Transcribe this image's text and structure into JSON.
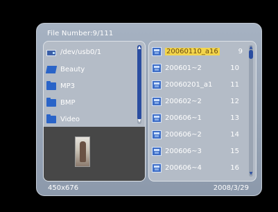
{
  "header": {
    "file_number": "File Number:9/111"
  },
  "footer": {
    "resolution": "450x676",
    "date": "2008/3/29"
  },
  "directory_list": {
    "items": [
      {
        "label": "/dev/usb0/1",
        "icon": "drive-icon"
      },
      {
        "label": "Beauty",
        "icon": "folder-open-icon"
      },
      {
        "label": "MP3",
        "icon": "folder-icon"
      },
      {
        "label": "BMP",
        "icon": "folder-icon"
      },
      {
        "label": "Video",
        "icon": "folder-icon"
      }
    ]
  },
  "preview": {
    "icon": "photo-thumbnail"
  },
  "file_list": {
    "selected_index": 0,
    "items": [
      {
        "name": "20060110_a16",
        "index": "9"
      },
      {
        "name": "200601~2",
        "index": "10"
      },
      {
        "name": "20060201_a1",
        "index": "11"
      },
      {
        "name": "200602~2",
        "index": "12"
      },
      {
        "name": "200606~1",
        "index": "13"
      },
      {
        "name": "200606~2",
        "index": "14"
      },
      {
        "name": "200606~3",
        "index": "15"
      },
      {
        "name": "200606~4",
        "index": "16"
      }
    ]
  },
  "colors": {
    "frame": "#96a3b5",
    "panel": "#b4bcc7",
    "selection": "#f3d54b",
    "scroll_thumb": "#2a4da0",
    "preview_bg": "#474747"
  }
}
